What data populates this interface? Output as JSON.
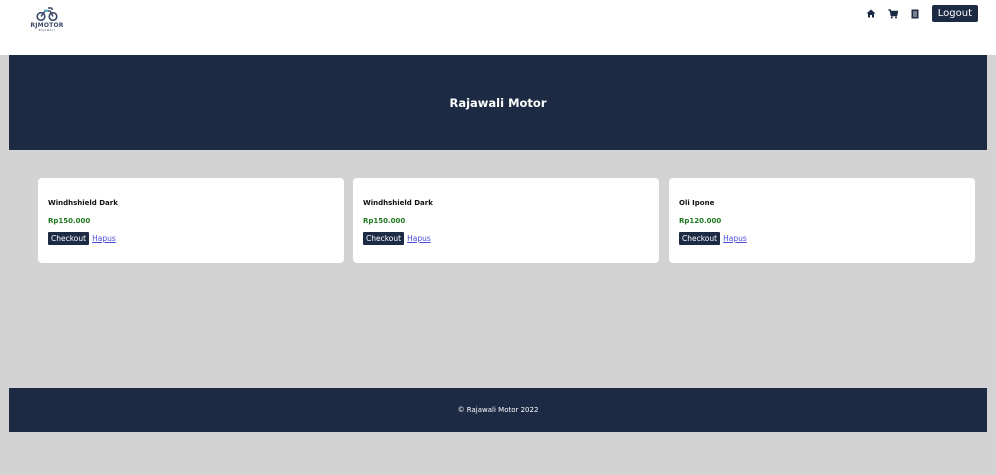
{
  "header": {
    "logo": {
      "text": "RJMOTOR",
      "subtext": "RAJAWALI",
      "icon": "motorcycle-icon"
    },
    "nav": {
      "home_icon": "home-icon",
      "cart_icon": "cart-icon",
      "orders_icon": "receipt-icon",
      "logout_label": "Logout"
    }
  },
  "hero": {
    "title": "Rajawali Motor"
  },
  "cart": {
    "items": [
      {
        "name": "Windhshield Dark",
        "price": "Rp150.000",
        "checkout_label": "Checkout",
        "remove_label": "Hapus"
      },
      {
        "name": "Windhshield Dark",
        "price": "Rp150.000",
        "checkout_label": "Checkout",
        "remove_label": "Hapus"
      },
      {
        "name": "Oli Ipone",
        "price": "Rp120.000",
        "checkout_label": "Checkout",
        "remove_label": "Hapus"
      }
    ]
  },
  "footer": {
    "text": "© Rajawali Motor 2022"
  },
  "colors": {
    "navy": "#1c2a44",
    "price_green": "#1f7a1f",
    "page_bg": "#d3d3d3",
    "link": "#4a4ad8"
  }
}
